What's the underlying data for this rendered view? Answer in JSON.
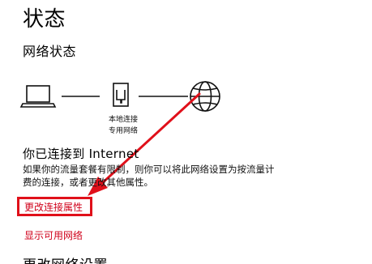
{
  "page_title": "状态",
  "section_title": "网络状态",
  "diagram": {
    "computer_icon": "laptop-icon",
    "adapter_icon": "ethernet-port-icon",
    "adapter_label_line1": "本地连接",
    "adapter_label_line2": "专用网络",
    "internet_icon": "globe-icon"
  },
  "status": {
    "heading": "你已连接到 Internet",
    "description_line1": "如果你的流量套餐有限制，则你可以将此网络设置为按流量计",
    "description_line2": "费的连接，或者更改其他属性。"
  },
  "links": {
    "change_properties": "更改连接属性",
    "show_available_networks": "显示可用网络"
  },
  "next_section_heading_partial": "更改网络设置",
  "annotation": {
    "color": "#e0101a"
  }
}
